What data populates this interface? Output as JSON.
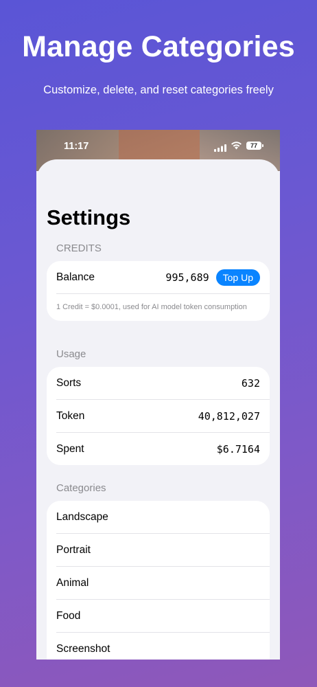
{
  "promo": {
    "headline": "Manage Categories",
    "subline": "Customize, delete, and reset categories freely"
  },
  "status_bar": {
    "time": "11:17",
    "battery": "77"
  },
  "settings": {
    "title": "Settings",
    "credits": {
      "section_label": "CREDITS",
      "balance_label": "Balance",
      "balance_value": "995,689",
      "top_up_label": "Top Up",
      "note": "1 Credit = $0.0001, used for AI model token consumption"
    },
    "usage": {
      "section_label": "Usage",
      "rows": [
        {
          "label": "Sorts",
          "value": "632"
        },
        {
          "label": "Token",
          "value": "40,812,027"
        },
        {
          "label": "Spent",
          "value": "$6.7164"
        }
      ]
    },
    "categories": {
      "section_label": "Categories",
      "items": [
        "Landscape",
        "Portrait",
        "Animal",
        "Food",
        "Screenshot"
      ]
    }
  },
  "colors": {
    "accent": "#0a84ff",
    "background_gradient_start": "#5a55d6",
    "background_gradient_end": "#8f58b9",
    "grouped_background": "#f2f2f7"
  },
  "icons": [
    "cellular-signal-icon",
    "wifi-icon",
    "battery-icon"
  ]
}
